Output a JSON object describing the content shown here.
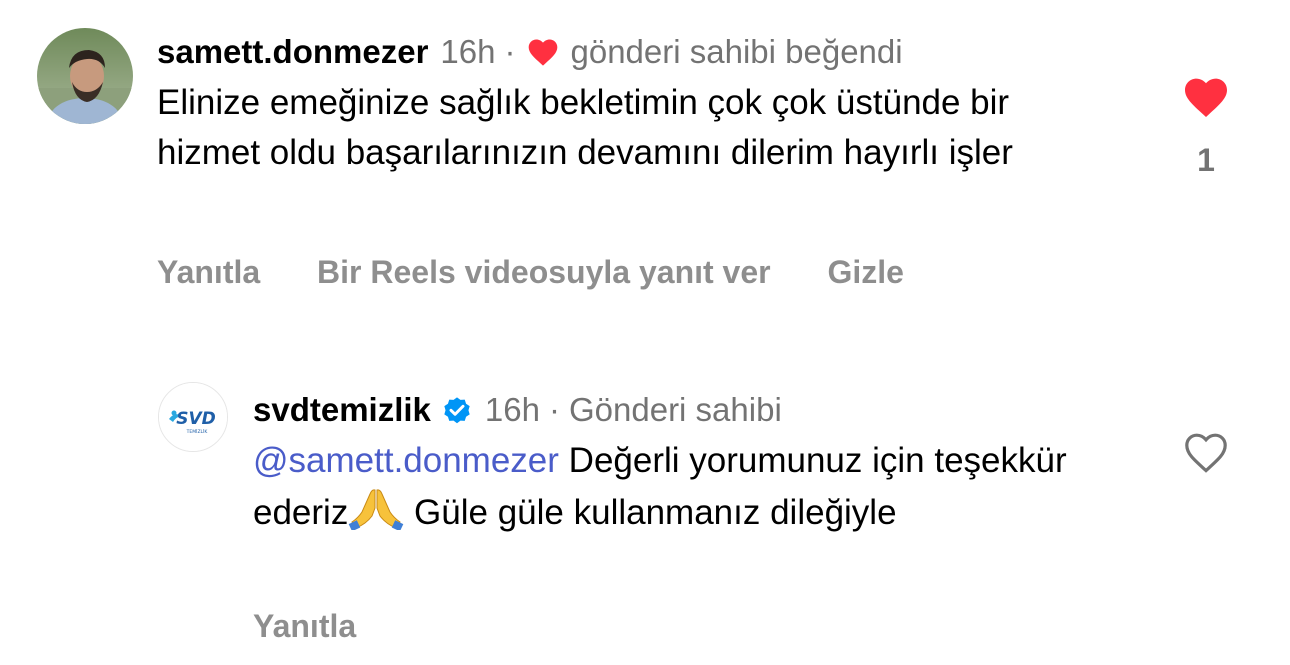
{
  "comments": [
    {
      "username": "samett.donmezer",
      "time": "16h",
      "separator": "·",
      "liked_by_owner": "gönderi sahibi beğendi",
      "text": "Elinize emeğinize sağlık bekletimin çok çok üstünde bir hizmet oldu başarılarınızın devamını dilerim hayırlı işler",
      "like_count": "1",
      "liked": true,
      "actions": {
        "reply": "Yanıtla",
        "reels_reply": "Bir Reels videosuyla yanıt ver",
        "hide": "Gizle"
      }
    },
    {
      "username": "svdtemizlik",
      "verified": true,
      "time": "16h",
      "separator": "·",
      "owner_label": "Gönderi sahibi",
      "mention": "@samett.donmezer",
      "text_part1": " Değerli yorumunuz için teşekkür ederiz",
      "emoji": "🙏",
      "text_part2": " Güle güle kullanmanız dileğiyle",
      "liked": false,
      "actions": {
        "reply": "Yanıtla"
      },
      "avatar_logo_text": "SVD",
      "avatar_logo_subtext": "TEMİZLİK"
    }
  ],
  "colors": {
    "heart_red": "#ff3040",
    "muted": "#737373",
    "mention": "#4a5cc9",
    "verified_blue": "#0095f6"
  }
}
